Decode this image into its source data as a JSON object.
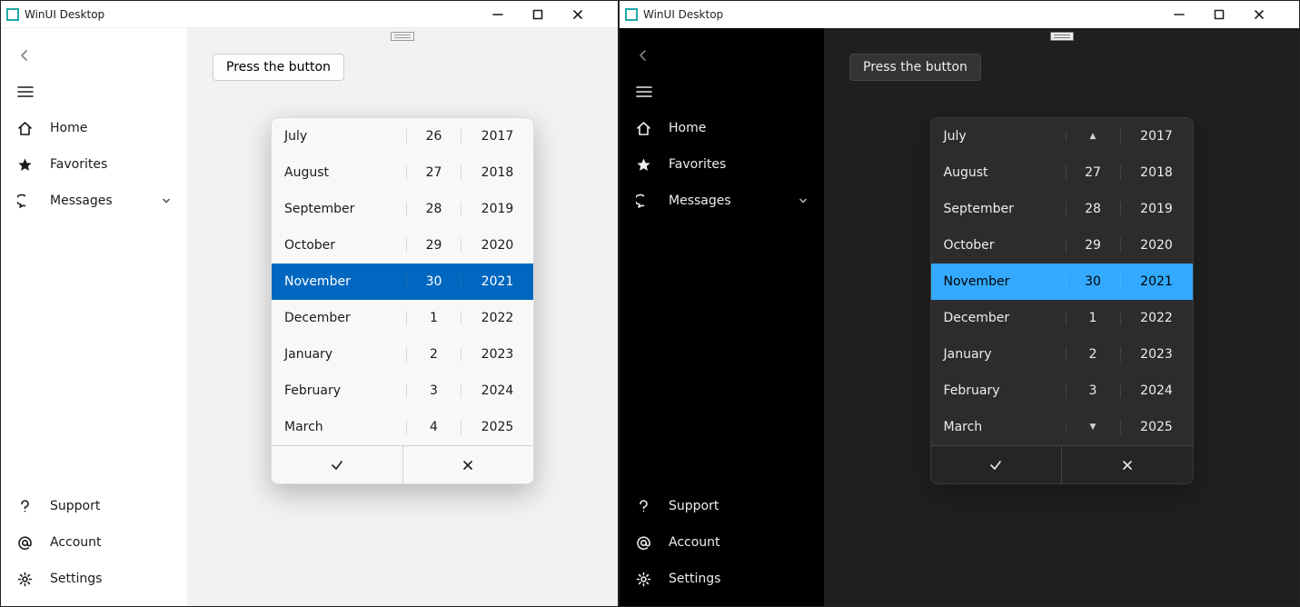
{
  "light": {
    "title": "WinUI Desktop",
    "nav": {
      "items": [
        {
          "icon": "home",
          "label": "Home"
        },
        {
          "icon": "star",
          "label": "Favorites"
        },
        {
          "icon": "chat",
          "label": "Messages",
          "expandable": true
        }
      ],
      "footer": [
        {
          "icon": "help",
          "label": "Support"
        },
        {
          "icon": "at",
          "label": "Account"
        },
        {
          "icon": "gear",
          "label": "Settings"
        }
      ]
    },
    "button_label": "Press the button",
    "picker": {
      "rows": [
        {
          "month": "July",
          "day": "26",
          "year": "2017"
        },
        {
          "month": "August",
          "day": "27",
          "year": "2018"
        },
        {
          "month": "September",
          "day": "28",
          "year": "2019"
        },
        {
          "month": "October",
          "day": "29",
          "year": "2020"
        },
        {
          "month": "November",
          "day": "30",
          "year": "2021",
          "selected": true
        },
        {
          "month": "December",
          "day": "1",
          "year": "2022"
        },
        {
          "month": "January",
          "day": "2",
          "year": "2023"
        },
        {
          "month": "February",
          "day": "3",
          "year": "2024"
        },
        {
          "month": "March",
          "day": "4",
          "year": "2025"
        }
      ],
      "day_arrows": false
    }
  },
  "dark": {
    "title": "WinUI Desktop",
    "nav": {
      "items": [
        {
          "icon": "home",
          "label": "Home"
        },
        {
          "icon": "star",
          "label": "Favorites"
        },
        {
          "icon": "chat",
          "label": "Messages",
          "expandable": true
        }
      ],
      "footer": [
        {
          "icon": "help",
          "label": "Support"
        },
        {
          "icon": "at",
          "label": "Account"
        },
        {
          "icon": "gear",
          "label": "Settings"
        }
      ]
    },
    "button_label": "Press the button",
    "picker": {
      "rows": [
        {
          "month": "July",
          "day": "▲",
          "year": "2017",
          "day_is_arrow": true
        },
        {
          "month": "August",
          "day": "27",
          "year": "2018"
        },
        {
          "month": "September",
          "day": "28",
          "year": "2019"
        },
        {
          "month": "October",
          "day": "29",
          "year": "2020"
        },
        {
          "month": "November",
          "day": "30",
          "year": "2021",
          "selected": true
        },
        {
          "month": "December",
          "day": "1",
          "year": "2022"
        },
        {
          "month": "January",
          "day": "2",
          "year": "2023"
        },
        {
          "month": "February",
          "day": "3",
          "year": "2024"
        },
        {
          "month": "March",
          "day": "▼",
          "year": "2025",
          "day_is_arrow": true
        }
      ],
      "day_arrows": true
    }
  }
}
